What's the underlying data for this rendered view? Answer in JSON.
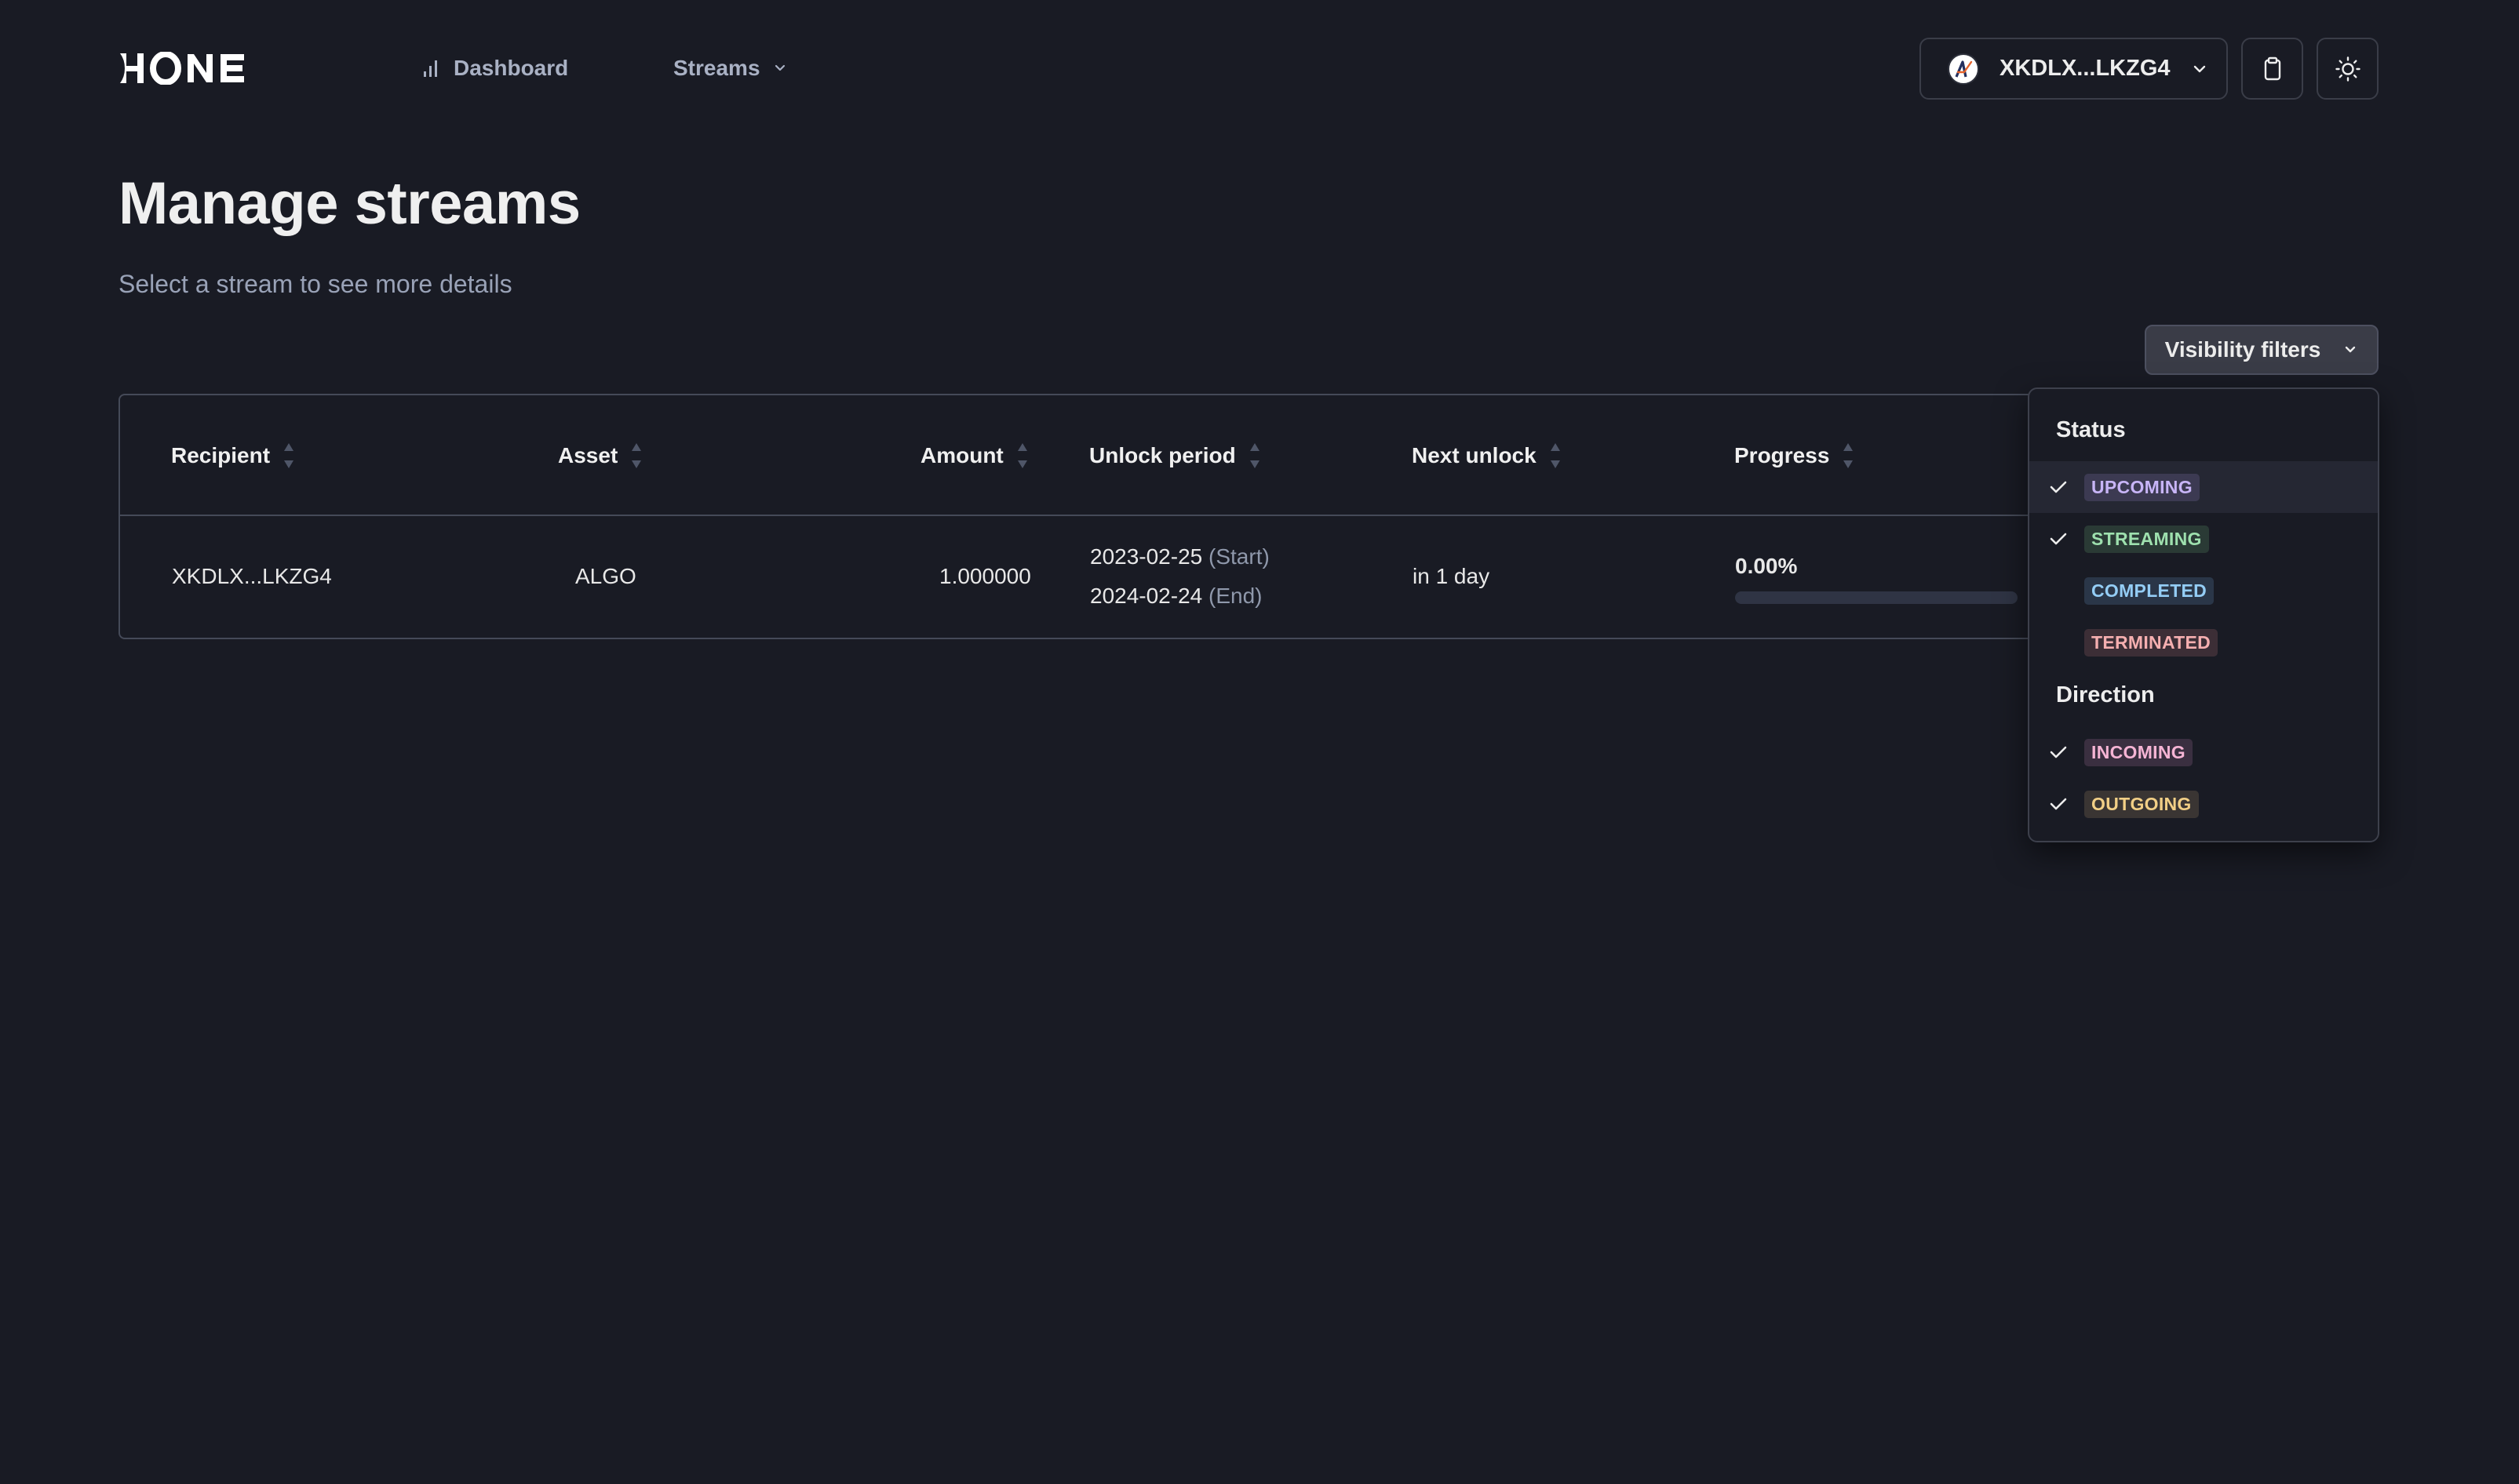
{
  "header": {
    "logo_text": "HONE",
    "nav": [
      {
        "label": "Dashboard",
        "icon": "bar-chart-icon"
      },
      {
        "label": "Streams",
        "icon": "chevron-down-icon"
      }
    ],
    "wallet": {
      "address": "XKDLX...LKZG4",
      "avatar_icon": "algorand-logo-icon"
    },
    "clipboard_icon": "clipboard-icon",
    "theme_icon": "sun-icon"
  },
  "main": {
    "title": "Manage streams",
    "subtitle": "Select a stream to see more details",
    "filters_button": "Visibility filters"
  },
  "table": {
    "columns": [
      "Recipient",
      "Asset",
      "Amount",
      "Unlock period",
      "Next unlock",
      "Progress"
    ],
    "rows": [
      {
        "recipient": "XKDLX...LKZG4",
        "asset": "ALGO",
        "amount": "1.000000",
        "start_date": "2023-02-25",
        "start_label": "(Start)",
        "end_date": "2024-02-24",
        "end_label": "(End)",
        "next_unlock": "in 1 day",
        "progress_text": "0.00%",
        "progress_value": 0
      }
    ]
  },
  "filters": {
    "status_title": "Status",
    "status": [
      {
        "label": "UPCOMING",
        "checked": true,
        "fg": "#c8b5f7",
        "bg": "#3c3a52"
      },
      {
        "label": "STREAMING",
        "checked": true,
        "fg": "#9ee0ae",
        "bg": "#2a3a35"
      },
      {
        "label": "COMPLETED",
        "checked": false,
        "fg": "#94cdf5",
        "bg": "#2a3648"
      },
      {
        "label": "TERMINATED",
        "checked": false,
        "fg": "#f5afb0",
        "bg": "#3c2e36"
      }
    ],
    "direction_title": "Direction",
    "direction": [
      {
        "label": "INCOMING",
        "checked": true,
        "fg": "#f5b4d4",
        "bg": "#3a2f40"
      },
      {
        "label": "OUTGOING",
        "checked": true,
        "fg": "#f2cf86",
        "bg": "#3a3533"
      }
    ]
  }
}
